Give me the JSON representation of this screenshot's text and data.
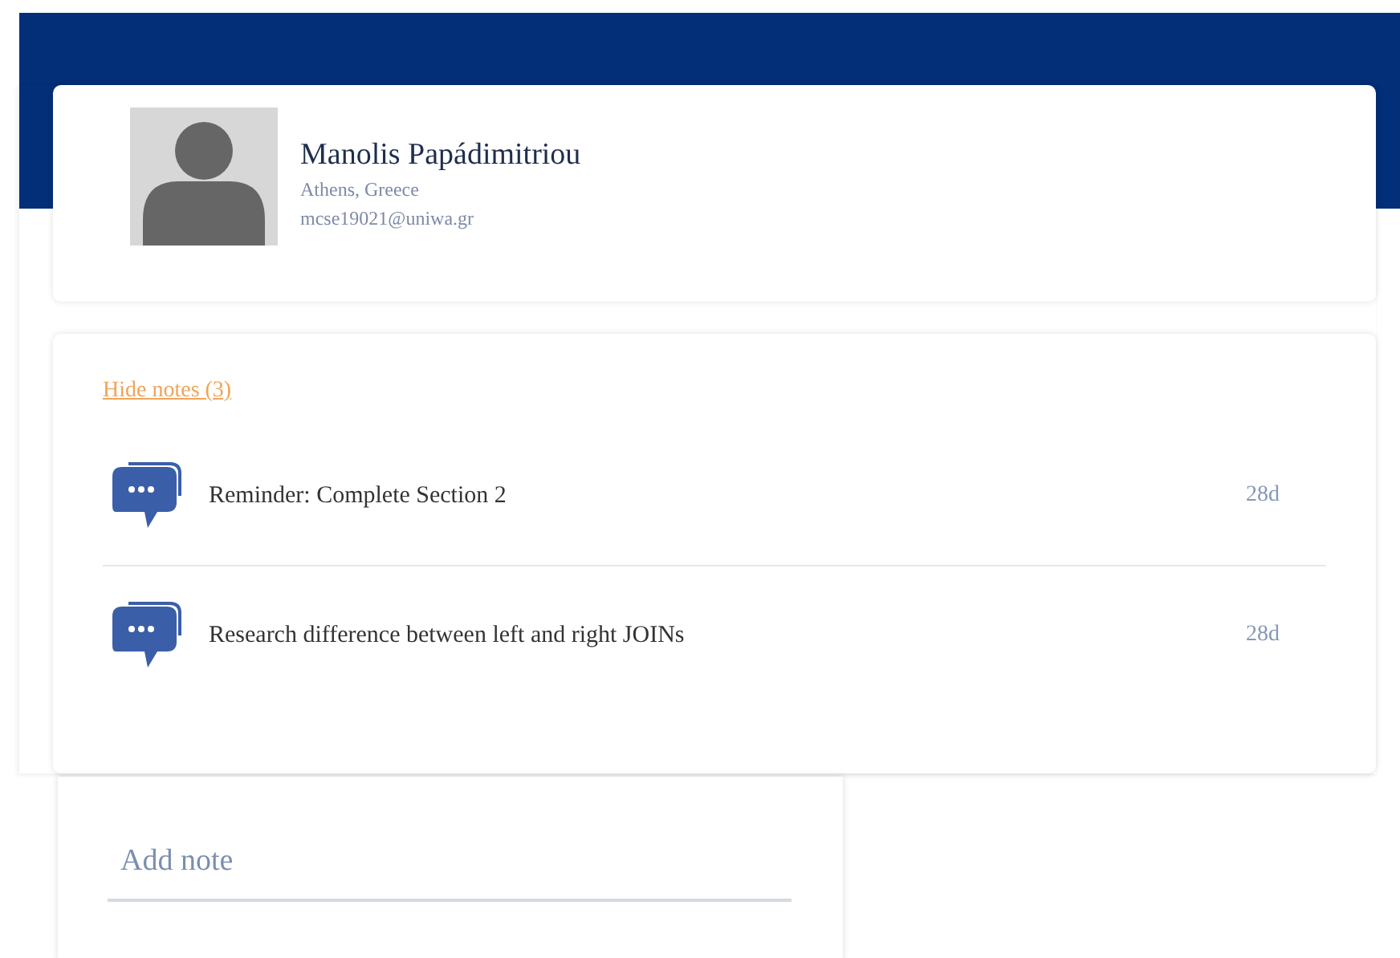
{
  "profile": {
    "name": "Manolis Papádimitriou",
    "location": "Athens, Greece",
    "email": "mcse19021@uniwa.gr"
  },
  "notes": {
    "toggle": "Hide notes (3)",
    "items": [
      {
        "text": "Reminder: Complete Section 2",
        "age": "28d"
      },
      {
        "text": "Research difference between left and right JOINs",
        "age": "28d"
      }
    ]
  },
  "add_note": {
    "placeholder": "Add note"
  }
}
